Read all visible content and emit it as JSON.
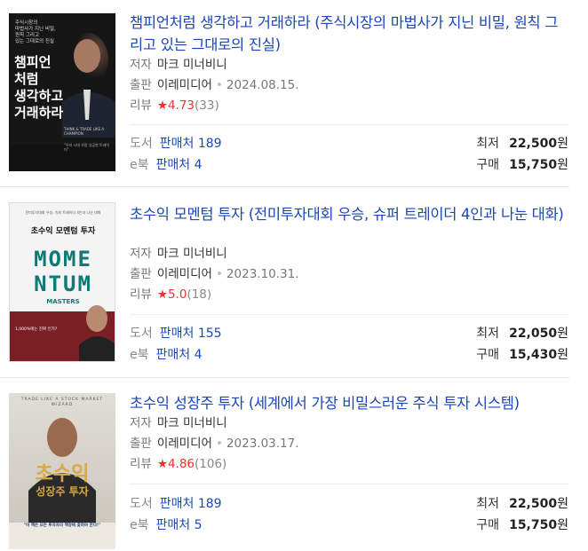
{
  "books": [
    {
      "title": "챔피언처럼 생각하고 거래하라 (주식시장의 마법사가 지닌 비밀, 원칙 그리고 있는 그대로의 진실)",
      "author_label": "저자",
      "author": "마크 미너비니",
      "publisher_label": "출판",
      "publisher": "이레미디어",
      "date": "2024.08.15.",
      "review_label": "리뷰",
      "rating": "4.73",
      "review_count": "(33)",
      "print_kind": "도서",
      "print_sellers": "판매처 189",
      "ebook_kind": "e북",
      "ebook_sellers": "판매처 4",
      "lowest_label": "최저",
      "lowest_price": "22,500",
      "buy_label": "구매",
      "buy_price": "15,750",
      "won": "원",
      "cover": {
        "top_text": "주식시장의\n마법사가 지닌 비밀,\n원칙 그리고\n있는 그대로의 진실",
        "title": "챔피언\n처럼\n생각하고\n거래하라",
        "subtitle": "THINK & TRADE LIKE A CHAMPION",
        "tagline": "\"우리 시대 가장 성공한 트레이더\""
      }
    },
    {
      "title": "초수익 모멘텀 투자 (전미투자대회 우승, 슈퍼 트레이더 4인과 나눈 대화)",
      "author_label": "저자",
      "author": "마크 미너비니",
      "publisher_label": "출판",
      "publisher": "이레미디어",
      "date": "2023.10.31.",
      "review_label": "리뷰",
      "rating": "5.0",
      "review_count": "(18)",
      "print_kind": "도서",
      "print_sellers": "판매처 155",
      "ebook_kind": "e북",
      "ebook_sellers": "판매처 4",
      "lowest_label": "최저",
      "lowest_price": "22,050",
      "buy_label": "구매",
      "buy_price": "15,430",
      "won": "원",
      "cover": {
        "top_text": "전미투자대회 우승, 슈퍼 트레이더 4인과 나눈 대화",
        "title": "초수익 모멘텀 투자",
        "big_line1": "MOME",
        "big_line2": "NTUM",
        "masters": "MASTERS",
        "bottom_text": "1,000%에는 진짜 인가?"
      }
    },
    {
      "title": "초수익 성장주 투자 (세계에서 가장 비밀스러운 주식 투자 시스템)",
      "author_label": "저자",
      "author": "마크 미너비니",
      "publisher_label": "출판",
      "publisher": "이레미디어",
      "date": "2023.03.17.",
      "review_label": "리뷰",
      "rating": "4.86",
      "review_count": "(106)",
      "print_kind": "도서",
      "print_sellers": "판매처 189",
      "ebook_kind": "e북",
      "ebook_sellers": "판매처 5",
      "lowest_label": "최저",
      "lowest_price": "22,500",
      "buy_label": "구매",
      "buy_price": "15,750",
      "won": "원",
      "cover": {
        "top_text": "TRADE LIKE A STOCK MARKET WIZARD",
        "title_line1": "초수익",
        "title_line2": "성장주 투자",
        "bottom_text": "\"이 책은 모든 투자자의 책장에 꽂혀야 한다!\""
      }
    }
  ],
  "colors": {
    "link": "#1a46b9",
    "star": "#f0322d"
  }
}
